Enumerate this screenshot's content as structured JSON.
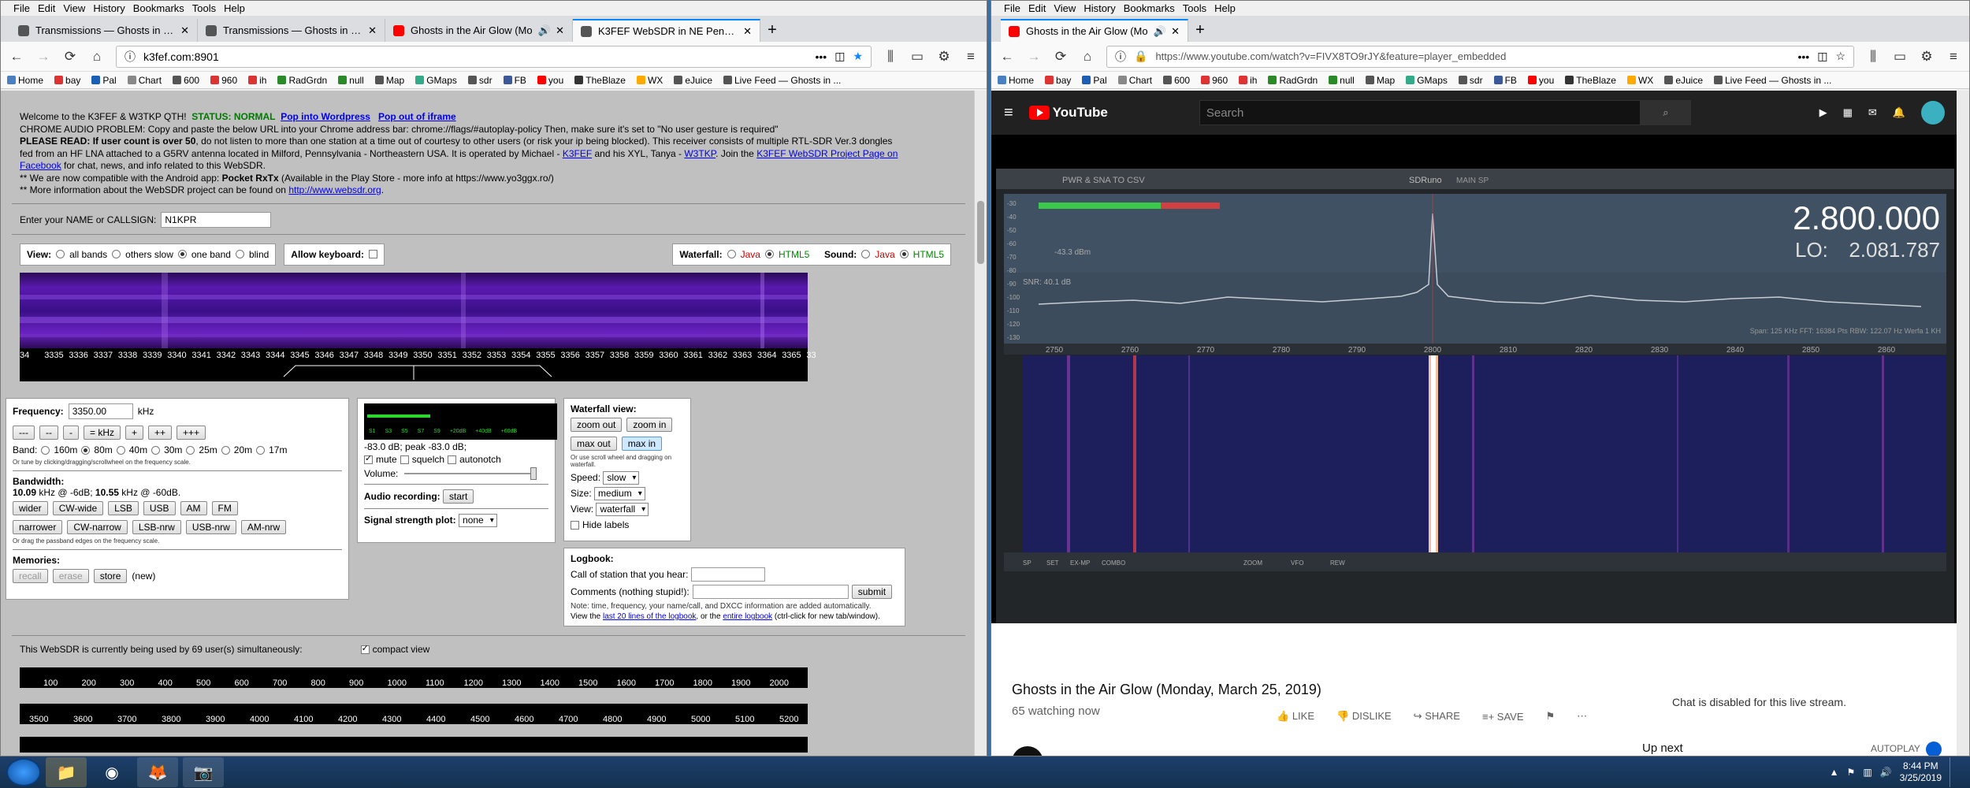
{
  "left": {
    "menu": [
      "File",
      "Edit",
      "View",
      "History",
      "Bookmarks",
      "Tools",
      "Help"
    ],
    "tabs": [
      {
        "label": "Transmissions — Ghosts in the",
        "color": "#555555"
      },
      {
        "label": "Transmissions — Ghosts in the",
        "color": "#555555"
      },
      {
        "label": "Ghosts in the Air Glow (Mo",
        "color": "#ff0000",
        "audio": "🔊"
      },
      {
        "label": "K3FEF WebSDR in NE Pennsylv",
        "color": "#555555"
      }
    ],
    "url": "k3fef.com:8901",
    "url_more": "•••",
    "bookmarks": [
      {
        "label": "Home",
        "color": "#4a7fc1"
      },
      {
        "label": "bay",
        "color": "#d33"
      },
      {
        "label": "Pal",
        "color": "#1a5fb4"
      },
      {
        "label": "Chart",
        "color": "#888"
      },
      {
        "label": "600",
        "color": "#555"
      },
      {
        "label": "960",
        "color": "#d33"
      },
      {
        "label": "ih",
        "color": "#d33"
      },
      {
        "label": "RadGrdn",
        "color": "#2a8a2a"
      },
      {
        "label": "null",
        "color": "#2a8a2a"
      },
      {
        "label": "Map",
        "color": "#555"
      },
      {
        "label": "GMaps",
        "color": "#3a8"
      },
      {
        "label": "sdr",
        "color": "#555"
      },
      {
        "label": "FB",
        "color": "#3b5998"
      },
      {
        "label": "you",
        "color": "#f00"
      },
      {
        "label": "TheBlaze",
        "color": "#333"
      },
      {
        "label": "WX",
        "color": "#fa0"
      },
      {
        "label": "eJuice",
        "color": "#555"
      },
      {
        "label": "Live Feed — Ghosts in ...",
        "color": "#555"
      }
    ],
    "intro": {
      "welcome": "Welcome to the K3FEF & W3TKP QTH!",
      "status": "STATUS: NORMAL",
      "pop_wordpress": "Pop into Wordpress",
      "pop_iframe": "Pop out of iframe",
      "chrome": "CHROME AUDIO PROBLEM: Copy and paste the below URL into your Chrome address bar: chrome://flags/#autoplay-policy Then, make sure it's set to \"No user gesture is required\"",
      "please_read": "PLEASE READ:",
      "user_count": "If user count is over 50",
      "line2b": ", do not listen to more than one station at a time out of courtesy to other users (or risk your ip being blocked). This receiver consists of multiple RTL-SDR Ver.3 dongles",
      "line3a": "fed from an HF LNA attached to a G5RV antenna located in Milford, Pennsylvania - Northeastern USA. It is operated by Michael -",
      "k3fef": "K3FEF",
      "line3b": "and his XYL, Tanya -",
      "w3tkp": "W3TKP",
      "line3c": ". Join the",
      "fbpage": "K3FEF WebSDR Project Page on",
      "facebook": "Facebook",
      "line4": "for chat, news, and info related to this WebSDR.",
      "android_a": "** We are now compatible with the Android app:",
      "android_b": "Pocket RxTx",
      "android_c": "(Available in the Play Store - more info at https://www.yo3ggx.ro/)",
      "more_a": "** More information about the WebSDR project can be found on",
      "more_link": "http://www.websdr.org",
      "more_b": "."
    },
    "name_label": "Enter your NAME or CALLSIGN:",
    "name_value": "N1KPR",
    "view_label": "View:",
    "view_options": [
      "all bands",
      "others slow",
      "one band",
      "blind"
    ],
    "allow_keyboard": "Allow keyboard:",
    "waterfall_label": "Waterfall:",
    "sound_label": "Sound:",
    "java": "Java",
    "html5": "HTML5",
    "freq_ticks": [
      "34",
      "3335",
      "3336",
      "3337",
      "3338",
      "3339",
      "3340",
      "3341",
      "3342",
      "3343",
      "3344",
      "3345",
      "3346",
      "3347",
      "3348",
      "3349",
      "3350",
      "3351",
      "3352",
      "3353",
      "3354",
      "3355",
      "3356",
      "3357",
      "3358",
      "3359",
      "3360",
      "3361",
      "3362",
      "3363",
      "3364",
      "3365",
      "33"
    ],
    "frequency_label": "Frequency:",
    "frequency_value": "3350.00",
    "khz": "kHz",
    "freq_buttons": [
      "---",
      "--",
      "-",
      "= kHz",
      "+",
      "++",
      "+++"
    ],
    "band_label": "Band:",
    "bands": [
      "160m",
      "80m",
      "40m",
      "30m",
      "25m",
      "20m",
      "17m"
    ],
    "tune_hint": "Or tune by clicking/dragging/scrollwheel on the frequency scale.",
    "bandwidth_label": "Bandwidth:",
    "bandwidth_a": "10.09",
    "bandwidth_b": "kHz @ -6dB;",
    "bandwidth_c": "10.55",
    "bandwidth_d": "kHz @ -60dB.",
    "mode_buttons_1": [
      "wider",
      "CW-wide",
      "LSB",
      "USB",
      "AM",
      "FM"
    ],
    "mode_buttons_2": [
      "narrower",
      "CW-narrow",
      "LSB-nrw",
      "USB-nrw",
      "AM-nrw"
    ],
    "drag_hint": "Or drag the passband edges on the frequency scale.",
    "memories_label": "Memories:",
    "mem_buttons": [
      "recall",
      "erase",
      "store"
    ],
    "mem_new": "(new)",
    "smeter_text": "-83.0 dB; peak  -83.0 dB;",
    "smeter_scale": [
      "S1",
      "S3",
      "S5",
      "S7",
      "S9",
      "+20dB",
      "+40dB",
      "+60dB"
    ],
    "mute": "mute",
    "squelch": "squelch",
    "autonotch": "autonotch",
    "volume": "Volume:",
    "audio_rec": "Audio recording:",
    "start": "start",
    "signal_plot": "Signal strength plot:",
    "signal_plot_value": "none",
    "wf_view": "Waterfall view:",
    "zoom_out": "zoom out",
    "zoom_in": "zoom in",
    "max_out": "max out",
    "max_in": "max in",
    "scroll_hint": "Or use scroll wheel and dragging on waterfall.",
    "speed_label": "Speed:",
    "speed_value": "slow",
    "size_label": "Size:",
    "size_value": "medium",
    "view2_label": "View:",
    "view2_value": "waterfall",
    "hide_labels": "Hide labels",
    "logbook": "Logbook:",
    "call_label": "Call of station that you hear:",
    "comments_label": "Comments (nothing stupid!):",
    "submit": "submit",
    "log_note": "Note: time, frequency, your name/call, and DXCC information are added automatically.",
    "log_view_a": "View the",
    "log_view_link1": "last 20 lines of the logbook",
    "log_view_b": ", or the",
    "log_view_link2": "entire logbook",
    "log_view_c": "(ctrl-click for new tab/window).",
    "users_text": "This WebSDR is currently being used by 69 user(s) simultaneously:",
    "compact_view": "compact view",
    "scale1": [
      "100",
      "200",
      "300",
      "400",
      "500",
      "600",
      "700",
      "800",
      "900",
      "1000",
      "1100",
      "1200",
      "1300",
      "1400",
      "1500",
      "1600",
      "1700",
      "1800",
      "1900",
      "2000"
    ],
    "scale2": [
      "3500",
      "3600",
      "3700",
      "3800",
      "3900",
      "4000",
      "4100",
      "4200",
      "4300",
      "4400",
      "4500",
      "4600",
      "4700",
      "4800",
      "4900",
      "5000",
      "5100",
      "5200"
    ]
  },
  "right": {
    "menu": [
      "File",
      "Edit",
      "View",
      "History",
      "Bookmarks",
      "Tools",
      "Help"
    ],
    "tab": "Ghosts in the Air Glow (Mo",
    "tab_audio": "🔊",
    "url": "https://www.youtube.com/watch?v=FIVX8TO9rJY&feature=player_embedded",
    "url_more": "•••",
    "youtube": "YouTube",
    "search_placeholder": "Search",
    "video_title": "Ghosts in the Air Glow (Monday, March 25, 2019)",
    "watching": "65 watching now",
    "like": "LIKE",
    "dislike": "DISLIKE",
    "share": "SHARE",
    "save": "SAVE",
    "chat_disabled": "Chat is disabled for this live stream.",
    "up_next": "Up next",
    "autoplay": "AUTOPLAY",
    "sdr_title": "PWR & SNA TO CSV",
    "sdr_brand": "SDRuno",
    "sdr_tab": "MAIN SP",
    "sdr_freq": "2.800.000",
    "sdr_lo_label": "LO:",
    "sdr_lo": "2.081.787",
    "sdr_dbm": "-43.3 dBm",
    "sdr_snr": "SNR: 40.1 dB",
    "sdr_span": "Span: 125 KHz  FFT: 16384 Pts  RBW: 122.07 Hz  Werfa 1 KH",
    "sdr_xticks": [
      "2750",
      "2760",
      "2770",
      "2780",
      "2790",
      "2800",
      "2810",
      "2820",
      "2830",
      "2840",
      "2850",
      "2860"
    ],
    "sdr_yticks": [
      "-30",
      "-40",
      "-50",
      "-60",
      "-70",
      "-80",
      "-90",
      "-100",
      "-110",
      "-120",
      "-130"
    ],
    "sdr_bottom": [
      "SP",
      "SET",
      "EX-MP",
      "COMBO",
      "ZOOM",
      "VFO",
      "REW"
    ]
  },
  "taskbar": {
    "time": "8:44 PM",
    "date": "3/25/2019"
  }
}
